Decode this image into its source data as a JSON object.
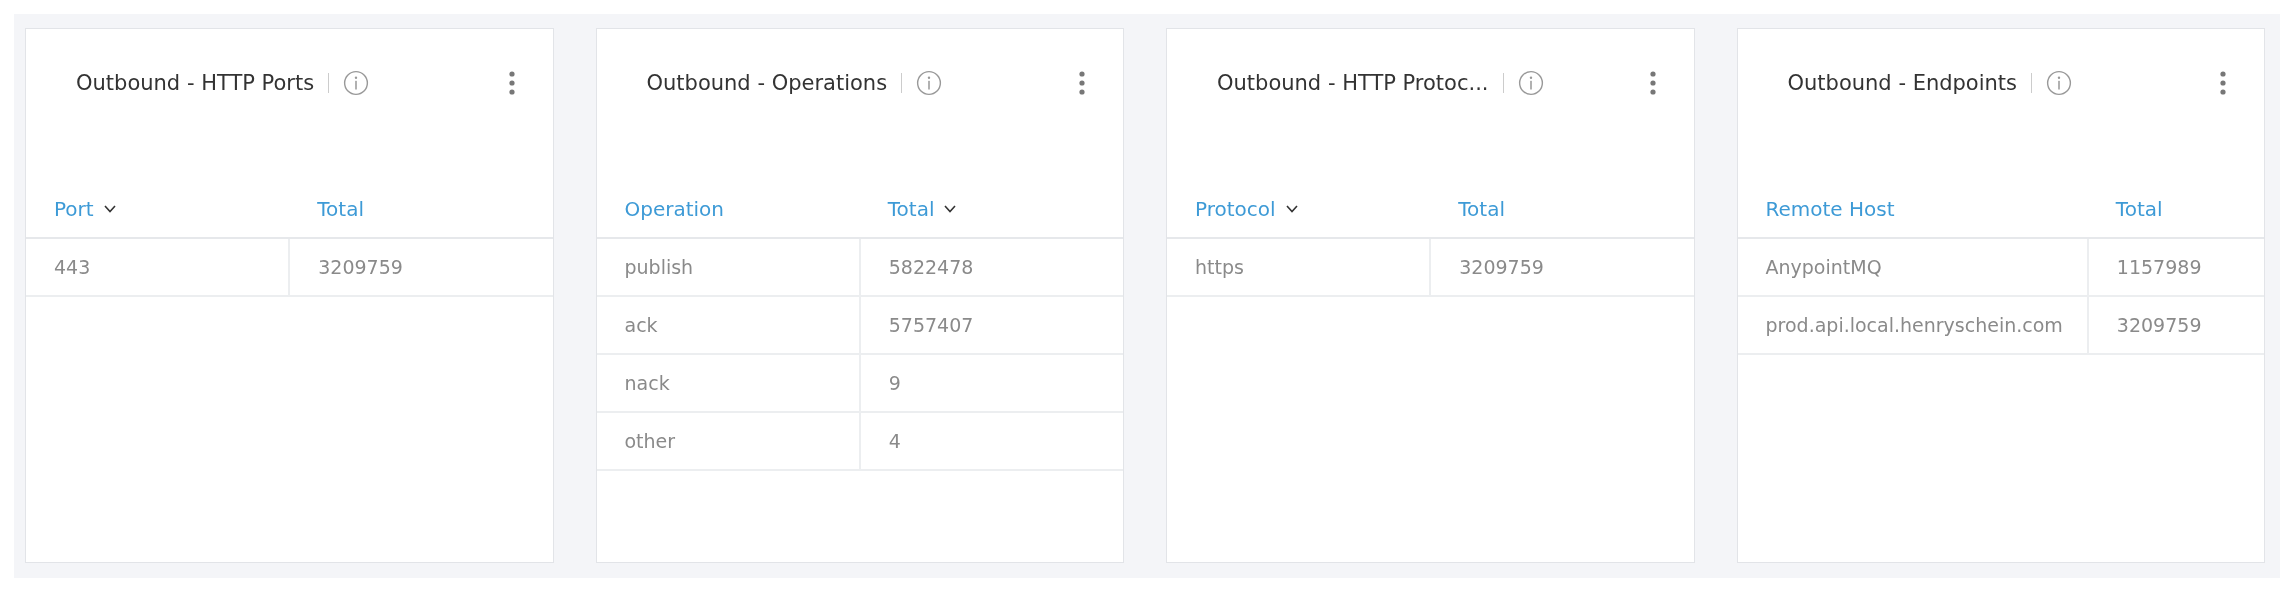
{
  "cards": [
    {
      "title": "Outbound - HTTP Ports",
      "table": {
        "columns": [
          {
            "label": "Port",
            "sorted": true
          },
          {
            "label": "Total",
            "sorted": false
          }
        ],
        "rows": [
          [
            "443",
            "3209759"
          ]
        ]
      }
    },
    {
      "title": "Outbound - Operations",
      "table": {
        "columns": [
          {
            "label": "Operation",
            "sorted": false
          },
          {
            "label": "Total",
            "sorted": true
          }
        ],
        "rows": [
          [
            "publish",
            "5822478"
          ],
          [
            "ack",
            "5757407"
          ],
          [
            "nack",
            "9"
          ],
          [
            "other",
            "4"
          ]
        ]
      }
    },
    {
      "title": "Outbound - HTTP Protoc...",
      "table": {
        "columns": [
          {
            "label": "Protocol",
            "sorted": true
          },
          {
            "label": "Total",
            "sorted": false
          }
        ],
        "rows": [
          [
            "https",
            "3209759"
          ]
        ]
      }
    },
    {
      "title": "Outbound - Endpoints",
      "table": {
        "columns": [
          {
            "label": "Remote Host",
            "sorted": false
          },
          {
            "label": "Total",
            "sorted": false
          }
        ],
        "rows": [
          [
            "AnypointMQ",
            "1157989"
          ],
          [
            "prod.api.local.henryschein.com",
            "3209759"
          ]
        ]
      }
    }
  ]
}
